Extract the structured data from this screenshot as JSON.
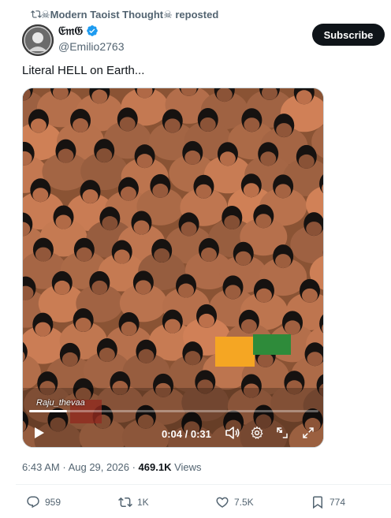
{
  "repost": {
    "text": "☠Modern Taoist Thought☠ reposted"
  },
  "author": {
    "name": "𝔈𝔪𝔊",
    "handle": "@Emilio2763",
    "verified": true
  },
  "subscribe_label": "Subscribe",
  "tweet_text": "Literal HELL on Earth...",
  "video": {
    "watermark": "Raju_thevaa",
    "time": "0:04 / 0:31",
    "progress": 0.13
  },
  "meta": {
    "time": "6:43 AM",
    "date": "Aug 29, 2026",
    "sep": "·",
    "views_count": "469.1K",
    "views_label": "Views"
  },
  "actions": {
    "replies": "959",
    "reposts": "1K",
    "likes": "7.5K",
    "bookmarks": "774"
  },
  "colors": {
    "text": "#0f1419",
    "muted": "#536471",
    "verified": "#1d9bf0",
    "button": "#0f1419"
  }
}
